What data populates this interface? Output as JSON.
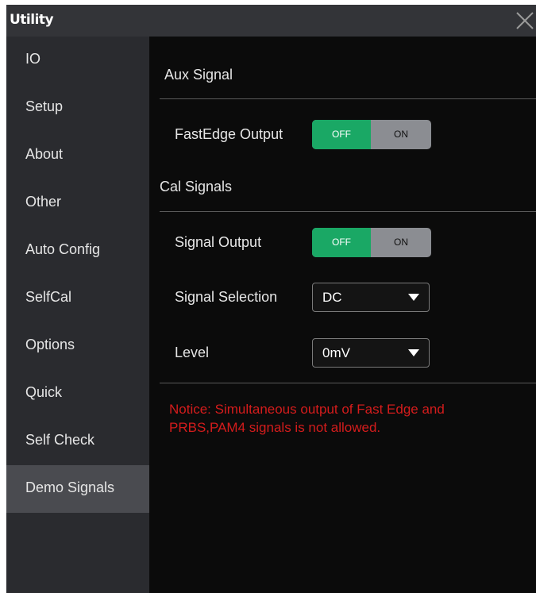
{
  "window": {
    "title": "Utility"
  },
  "sidebar": {
    "items": [
      {
        "label": "IO"
      },
      {
        "label": "Setup"
      },
      {
        "label": "About"
      },
      {
        "label": "Other"
      },
      {
        "label": "Auto Config"
      },
      {
        "label": "SelfCal"
      },
      {
        "label": "Options"
      },
      {
        "label": "Quick"
      },
      {
        "label": "Self Check"
      },
      {
        "label": "Demo Signals"
      }
    ],
    "active": "Demo Signals"
  },
  "aux_signal": {
    "title": "Aux Signal",
    "fastedge": {
      "label": "FastEdge Output",
      "off_label": "OFF",
      "on_label": "ON",
      "state": "OFF"
    }
  },
  "cal_signals": {
    "title": "Cal Signals",
    "signal_output": {
      "label": "Signal Output",
      "off_label": "OFF",
      "on_label": "ON",
      "state": "OFF"
    },
    "signal_selection": {
      "label": "Signal Selection",
      "value": "DC"
    },
    "level": {
      "label": "Level",
      "value": "0mV"
    }
  },
  "notice": "Notice: Simultaneous output of Fast Edge and PRBS,PAM4 signals is not allowed.",
  "colors": {
    "toggle_active": "#1aa865",
    "notice": "#d41c1c",
    "sidebar_active": "#4a4b50"
  }
}
